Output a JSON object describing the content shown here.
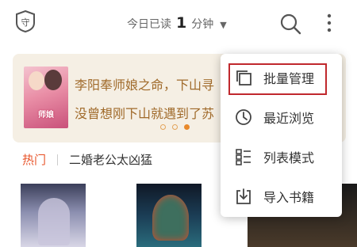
{
  "topbar": {
    "read_today_prefix": "今日已读",
    "read_today_count": "1",
    "read_today_unit": "分钟",
    "dropdown_glyph": "▼"
  },
  "banner": {
    "cover_title": "师娘",
    "line1": "李阳奉师娘之命，下山寻",
    "line2": "没曾想刚下山就遇到了苏",
    "dots_total": 3,
    "dots_active_index": 2
  },
  "tags": {
    "hot": "热门",
    "book": "二婚老公太凶猛"
  },
  "menu": {
    "items": [
      {
        "label": "批量管理",
        "icon": "batch-manage-icon"
      },
      {
        "label": "最近浏览",
        "icon": "clock-icon"
      },
      {
        "label": "列表模式",
        "icon": "list-mode-icon"
      },
      {
        "label": "导入书籍",
        "icon": "import-icon"
      }
    ]
  },
  "colors": {
    "accent": "#e8552b",
    "banner_text": "#a06a2a",
    "highlight_border": "#c0282d"
  }
}
